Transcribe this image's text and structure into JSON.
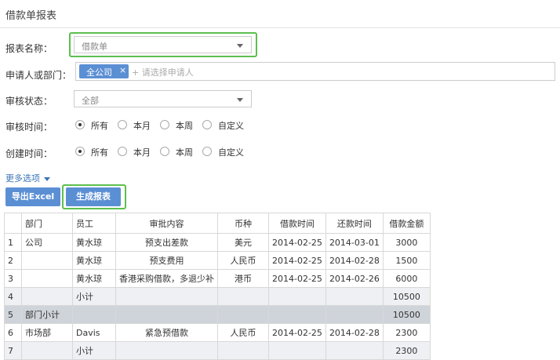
{
  "page": {
    "title": "借款单报表"
  },
  "form": {
    "report_name": {
      "label": "报表名称：",
      "value": "借款单"
    },
    "applicant": {
      "label": "申请人或部门：",
      "tag": "全公司",
      "tag_close": "×",
      "placeholder": "+ 请选择申请人"
    },
    "audit_status": {
      "label": "审核状态：",
      "value": "全部"
    },
    "audit_time": {
      "label": "审核时间：",
      "options": [
        "所有",
        "本月",
        "本周",
        "自定义"
      ],
      "selected": "所有"
    },
    "create_time": {
      "label": "创建时间：",
      "options": [
        "所有",
        "本月",
        "本周",
        "自定义"
      ],
      "selected": "所有"
    },
    "more_options": "更多选项"
  },
  "buttons": {
    "export": "导出Excel",
    "generate": "生成报表"
  },
  "table": {
    "columns": [
      "",
      "部门",
      "员工",
      "审批内容",
      "币种",
      "借款时间",
      "还款时间",
      "借款金额"
    ],
    "rows": [
      {
        "idx": "1",
        "dept": "公司",
        "employee": "黄水琼",
        "content": "预支出差款",
        "currency": "美元",
        "borrow_date": "2014-02-25",
        "repay_date": "2014-03-01",
        "amount": "3000",
        "type": "normal"
      },
      {
        "idx": "2",
        "dept": "",
        "employee": "黄水琼",
        "content": "预支费用",
        "currency": "人民币",
        "borrow_date": "2014-02-25",
        "repay_date": "2014-02-28",
        "amount": "1500",
        "type": "normal"
      },
      {
        "idx": "3",
        "dept": "",
        "employee": "黄水琼",
        "content": "香港采购借款，多退少补",
        "currency": "港币",
        "borrow_date": "2014-02-25",
        "repay_date": "2014-02-26",
        "amount": "6000",
        "type": "normal"
      },
      {
        "idx": "4",
        "dept": "",
        "employee": "小计",
        "content": "",
        "currency": "",
        "borrow_date": "",
        "repay_date": "",
        "amount": "10500",
        "type": "subtotal"
      },
      {
        "idx": "5",
        "dept": "部门小计",
        "employee": "",
        "content": "",
        "currency": "",
        "borrow_date": "",
        "repay_date": "",
        "amount": "10500",
        "type": "dept"
      },
      {
        "idx": "6",
        "dept": "市场部",
        "employee": "Davis",
        "content": "紧急预借款",
        "currency": "人民币",
        "borrow_date": "2014-02-25",
        "repay_date": "2014-02-28",
        "amount": "2300",
        "type": "normal"
      },
      {
        "idx": "7",
        "dept": "",
        "employee": "小计",
        "content": "",
        "currency": "",
        "borrow_date": "",
        "repay_date": "",
        "amount": "2300",
        "type": "subtotal"
      }
    ]
  },
  "colors": {
    "accent": "#5b8fd4",
    "highlight": "#5cbf4f",
    "link": "#3a74b8"
  }
}
